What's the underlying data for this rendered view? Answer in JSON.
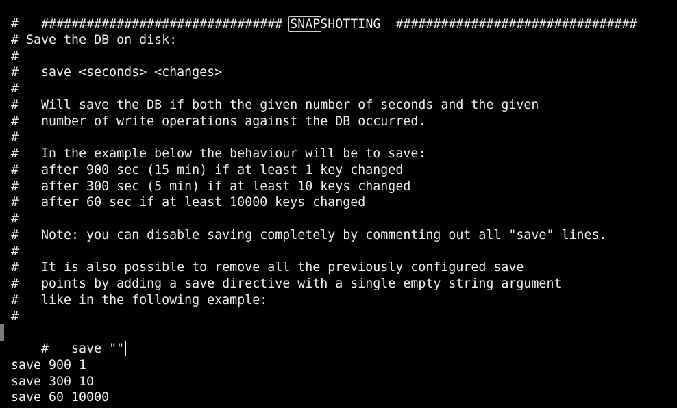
{
  "editor": {
    "header": {
      "left": "################################ ",
      "match": "SNAP",
      "rest": "SHOTTING  ################################"
    },
    "lines": [
      "#",
      "# Save the DB on disk:",
      "#",
      "#   save <seconds> <changes>",
      "#",
      "#   Will save the DB if both the given number of seconds and the given",
      "#   number of write operations against the DB occurred.",
      "#",
      "#   In the example below the behaviour will be to save:",
      "#   after 900 sec (15 min) if at least 1 key changed",
      "#   after 300 sec (5 min) if at least 10 keys changed",
      "#   after 60 sec if at least 10000 keys changed",
      "#",
      "#   Note: you can disable saving completely by commenting out all \"save\" lines.",
      "#",
      "#   It is also possible to remove all the previously configured save",
      "#   points by adding a save directive with a single empty string argument",
      "#   like in the following example:",
      "#",
      "#   save \"\"",
      "",
      "save 900 1",
      "save 300 10",
      "save 60 10000"
    ]
  }
}
